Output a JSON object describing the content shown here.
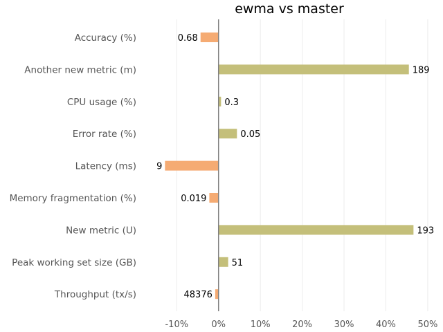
{
  "chart_data": {
    "type": "bar",
    "orientation": "horizontal",
    "title": "ewma vs master",
    "xlabel": "",
    "ylabel": "",
    "xlim": [
      -16.5,
      52
    ],
    "grid": "vertical",
    "legend": "none",
    "x_ticks": [
      {
        "value": -10,
        "label": "-10%"
      },
      {
        "value": 0,
        "label": "0%"
      },
      {
        "value": 10,
        "label": "10%"
      },
      {
        "value": 20,
        "label": "20%"
      },
      {
        "value": 30,
        "label": "30%"
      },
      {
        "value": 40,
        "label": "40%"
      },
      {
        "value": 50,
        "label": "50%"
      }
    ],
    "categories": [
      "Accuracy (%)",
      "Another new metric (m)",
      "CPU usage (%)",
      "Error rate (%)",
      "Latency (ms)",
      "Memory fragmentation (%)",
      "New metric (U)",
      "Peak working set size (GB)",
      "Throughput (tx/s)"
    ],
    "values": [
      -4.3,
      45.5,
      0.6,
      4.4,
      -12.8,
      -2.2,
      46.6,
      2.3,
      -0.8
    ],
    "bar_labels": [
      "0.68",
      "189",
      "0.3",
      "0.05",
      "9",
      "0.019",
      "193",
      "51",
      "48376"
    ],
    "colors": {
      "positive": "#c4bf7a",
      "negative": "#f5ab73",
      "zero_line": "#808080",
      "grid": "#ececec"
    }
  }
}
